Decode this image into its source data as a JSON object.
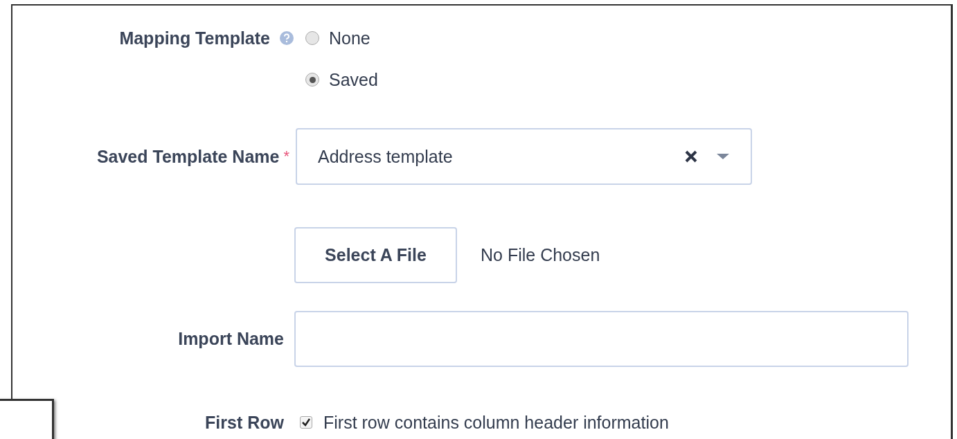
{
  "mapping_template": {
    "label": "Mapping Template",
    "options": [
      {
        "label": "None",
        "selected": false
      },
      {
        "label": "Saved",
        "selected": true
      }
    ]
  },
  "saved_template_name": {
    "label": "Saved Template Name",
    "required_mark": "*",
    "value": "Address template"
  },
  "file": {
    "button": "Select A File",
    "status": "No File Chosen"
  },
  "import_name": {
    "label": "Import Name"
  },
  "first_row": {
    "label": "First Row",
    "checkbox_label": "First row contains column header information",
    "checked": true
  }
}
